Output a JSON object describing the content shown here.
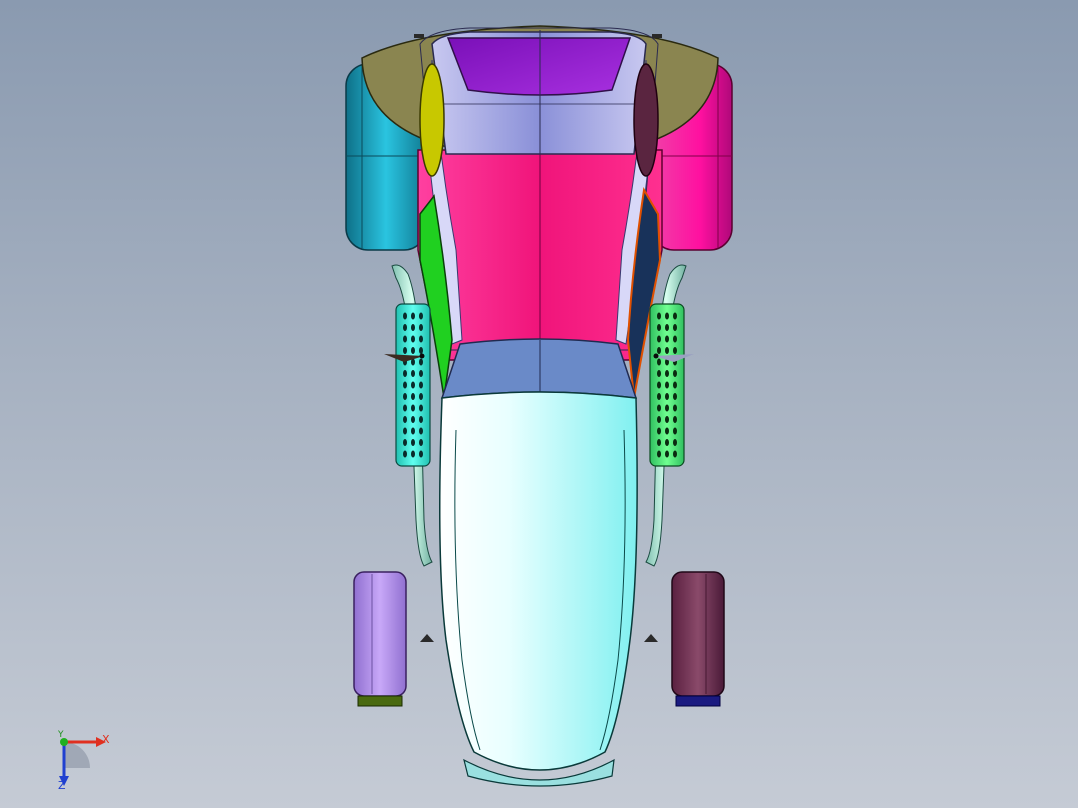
{
  "viewport": {
    "background_top": "#8a9ab0",
    "background_bottom": "#c5cbd5"
  },
  "model": {
    "colors": {
      "rear_hood": "#8a8550",
      "canopy_top": "#9b1fd0",
      "canopy_glass": "#7a7fc8",
      "body_magenta": "#f0147a",
      "left_rear_wheel": "#1aa6c4",
      "right_rear_wheel": "#e0108a",
      "left_side_window": "#c8c800",
      "left_side_panel": "#20d020",
      "right_side_panel": "#18325a",
      "right_rear_window": "#5a2540",
      "front_windshield": "#6a8ac8",
      "nose": "#a8f4f4",
      "exhaust_left": "#40e8d0",
      "exhaust_right": "#38d878",
      "front_left_wheel": "#b088e8",
      "front_right_wheel": "#6a2f52",
      "left_wheel_base": "#4a6a10",
      "right_wheel_base": "#1a1a80"
    }
  },
  "triad": {
    "x_label": "X",
    "y_label": "Y",
    "z_label": "Z",
    "x_color": "#e03020",
    "y_color": "#20a020",
    "z_color": "#2040d0"
  }
}
